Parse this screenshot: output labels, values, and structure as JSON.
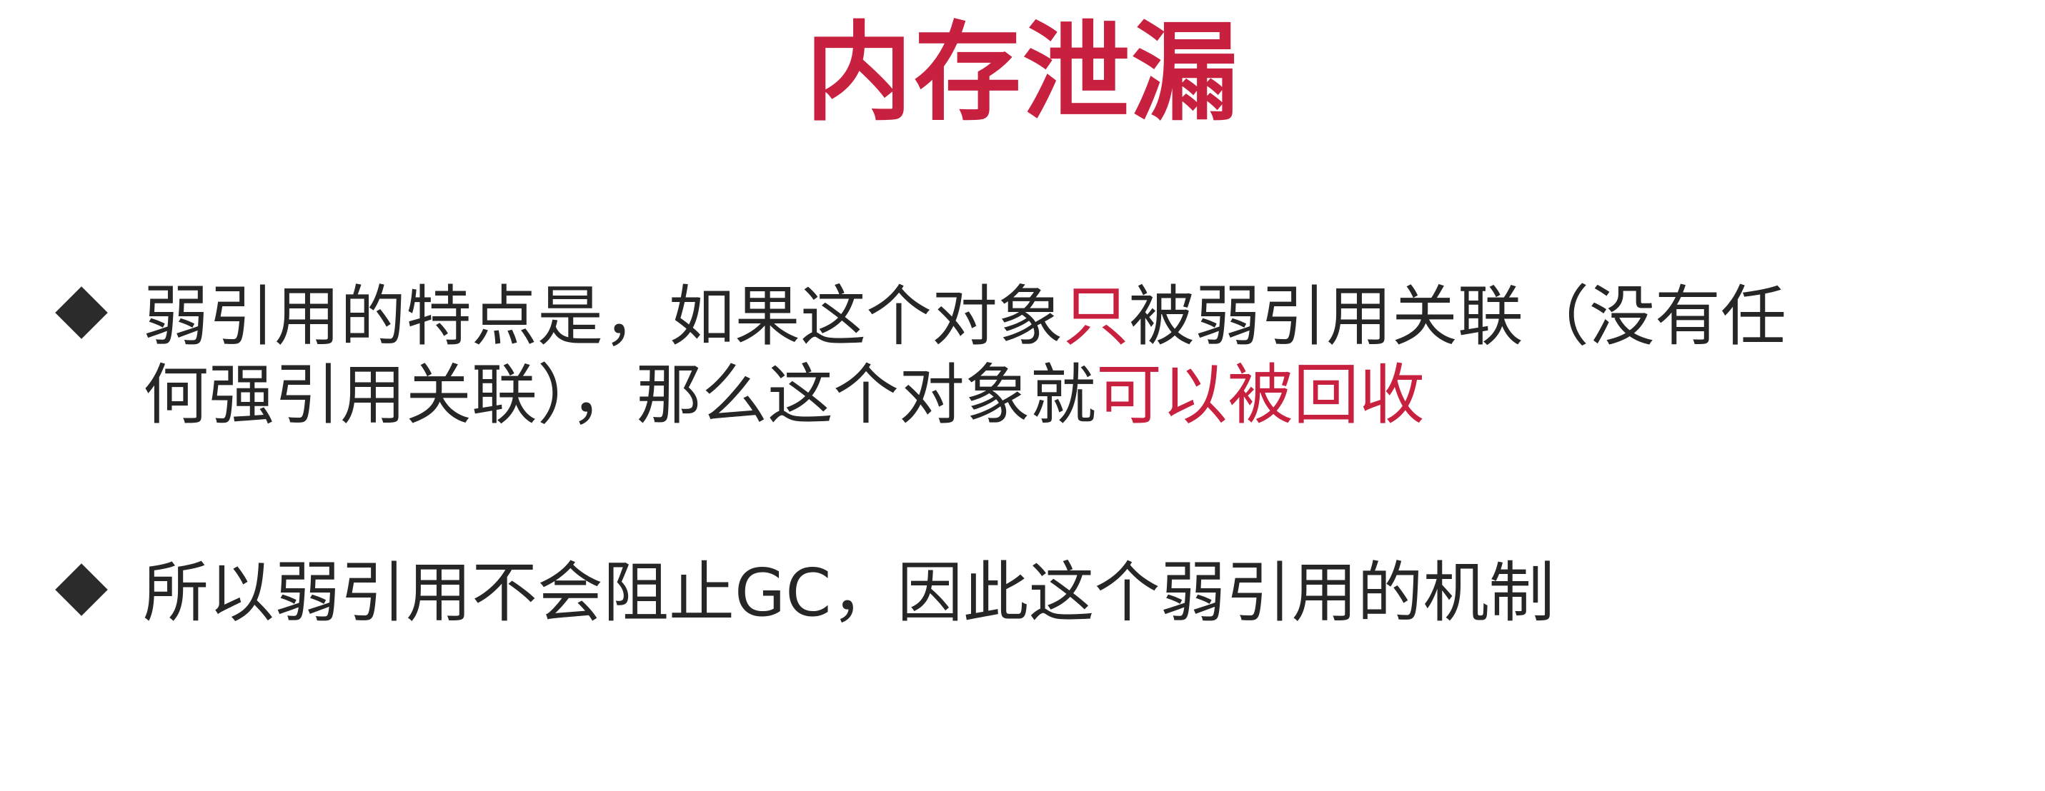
{
  "slide": {
    "title": "内存泄漏",
    "colors": {
      "title": "#c8203f",
      "text": "#262626",
      "highlight": "#c8203f",
      "bullet": "#2b2b2b"
    },
    "bullets": [
      {
        "icon": "diamond-bullet-icon",
        "line1": {
          "part1": "弱引用的特点是，如果这个对象",
          "highlight": "只",
          "part2": "被弱引用关联（没有任"
        },
        "line2": {
          "part1": "何强引用关联），那么这个对象就",
          "highlight": "可以被回收"
        }
      },
      {
        "icon": "diamond-bullet-icon",
        "line1": {
          "text": "所以弱引用不会阻止GC，因此这个弱引用的机制"
        }
      }
    ]
  }
}
